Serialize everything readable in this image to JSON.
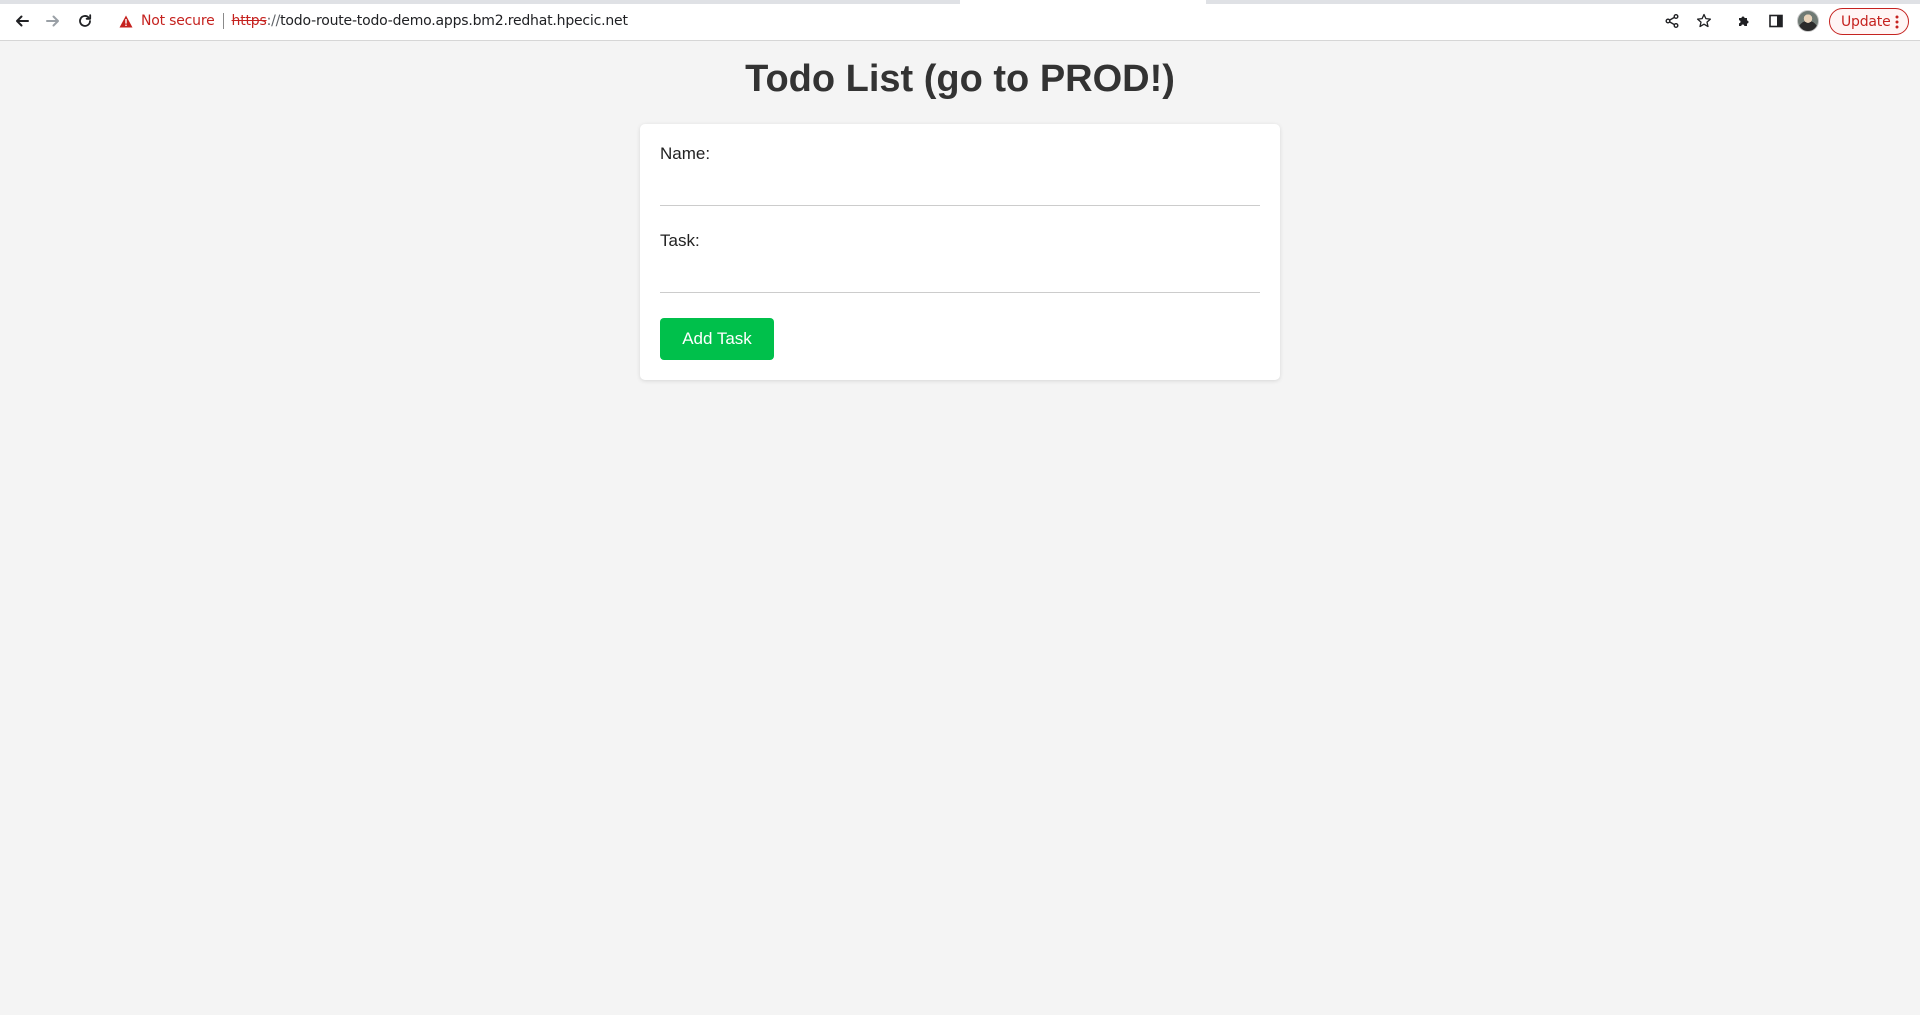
{
  "browser": {
    "security_status": "Not secure",
    "url_scheme": "https",
    "url_separator": "://",
    "url_host": "todo-route-todo-demo.apps.bm2.redhat.hpecic.net",
    "update_label": "Update",
    "warning_color": "#c5221f"
  },
  "page": {
    "title": "Todo List (go to PROD!)"
  },
  "form": {
    "name_label": "Name:",
    "name_value": "",
    "task_label": "Task:",
    "task_value": "",
    "submit_label": "Add Task",
    "submit_color": "#00c04b"
  }
}
